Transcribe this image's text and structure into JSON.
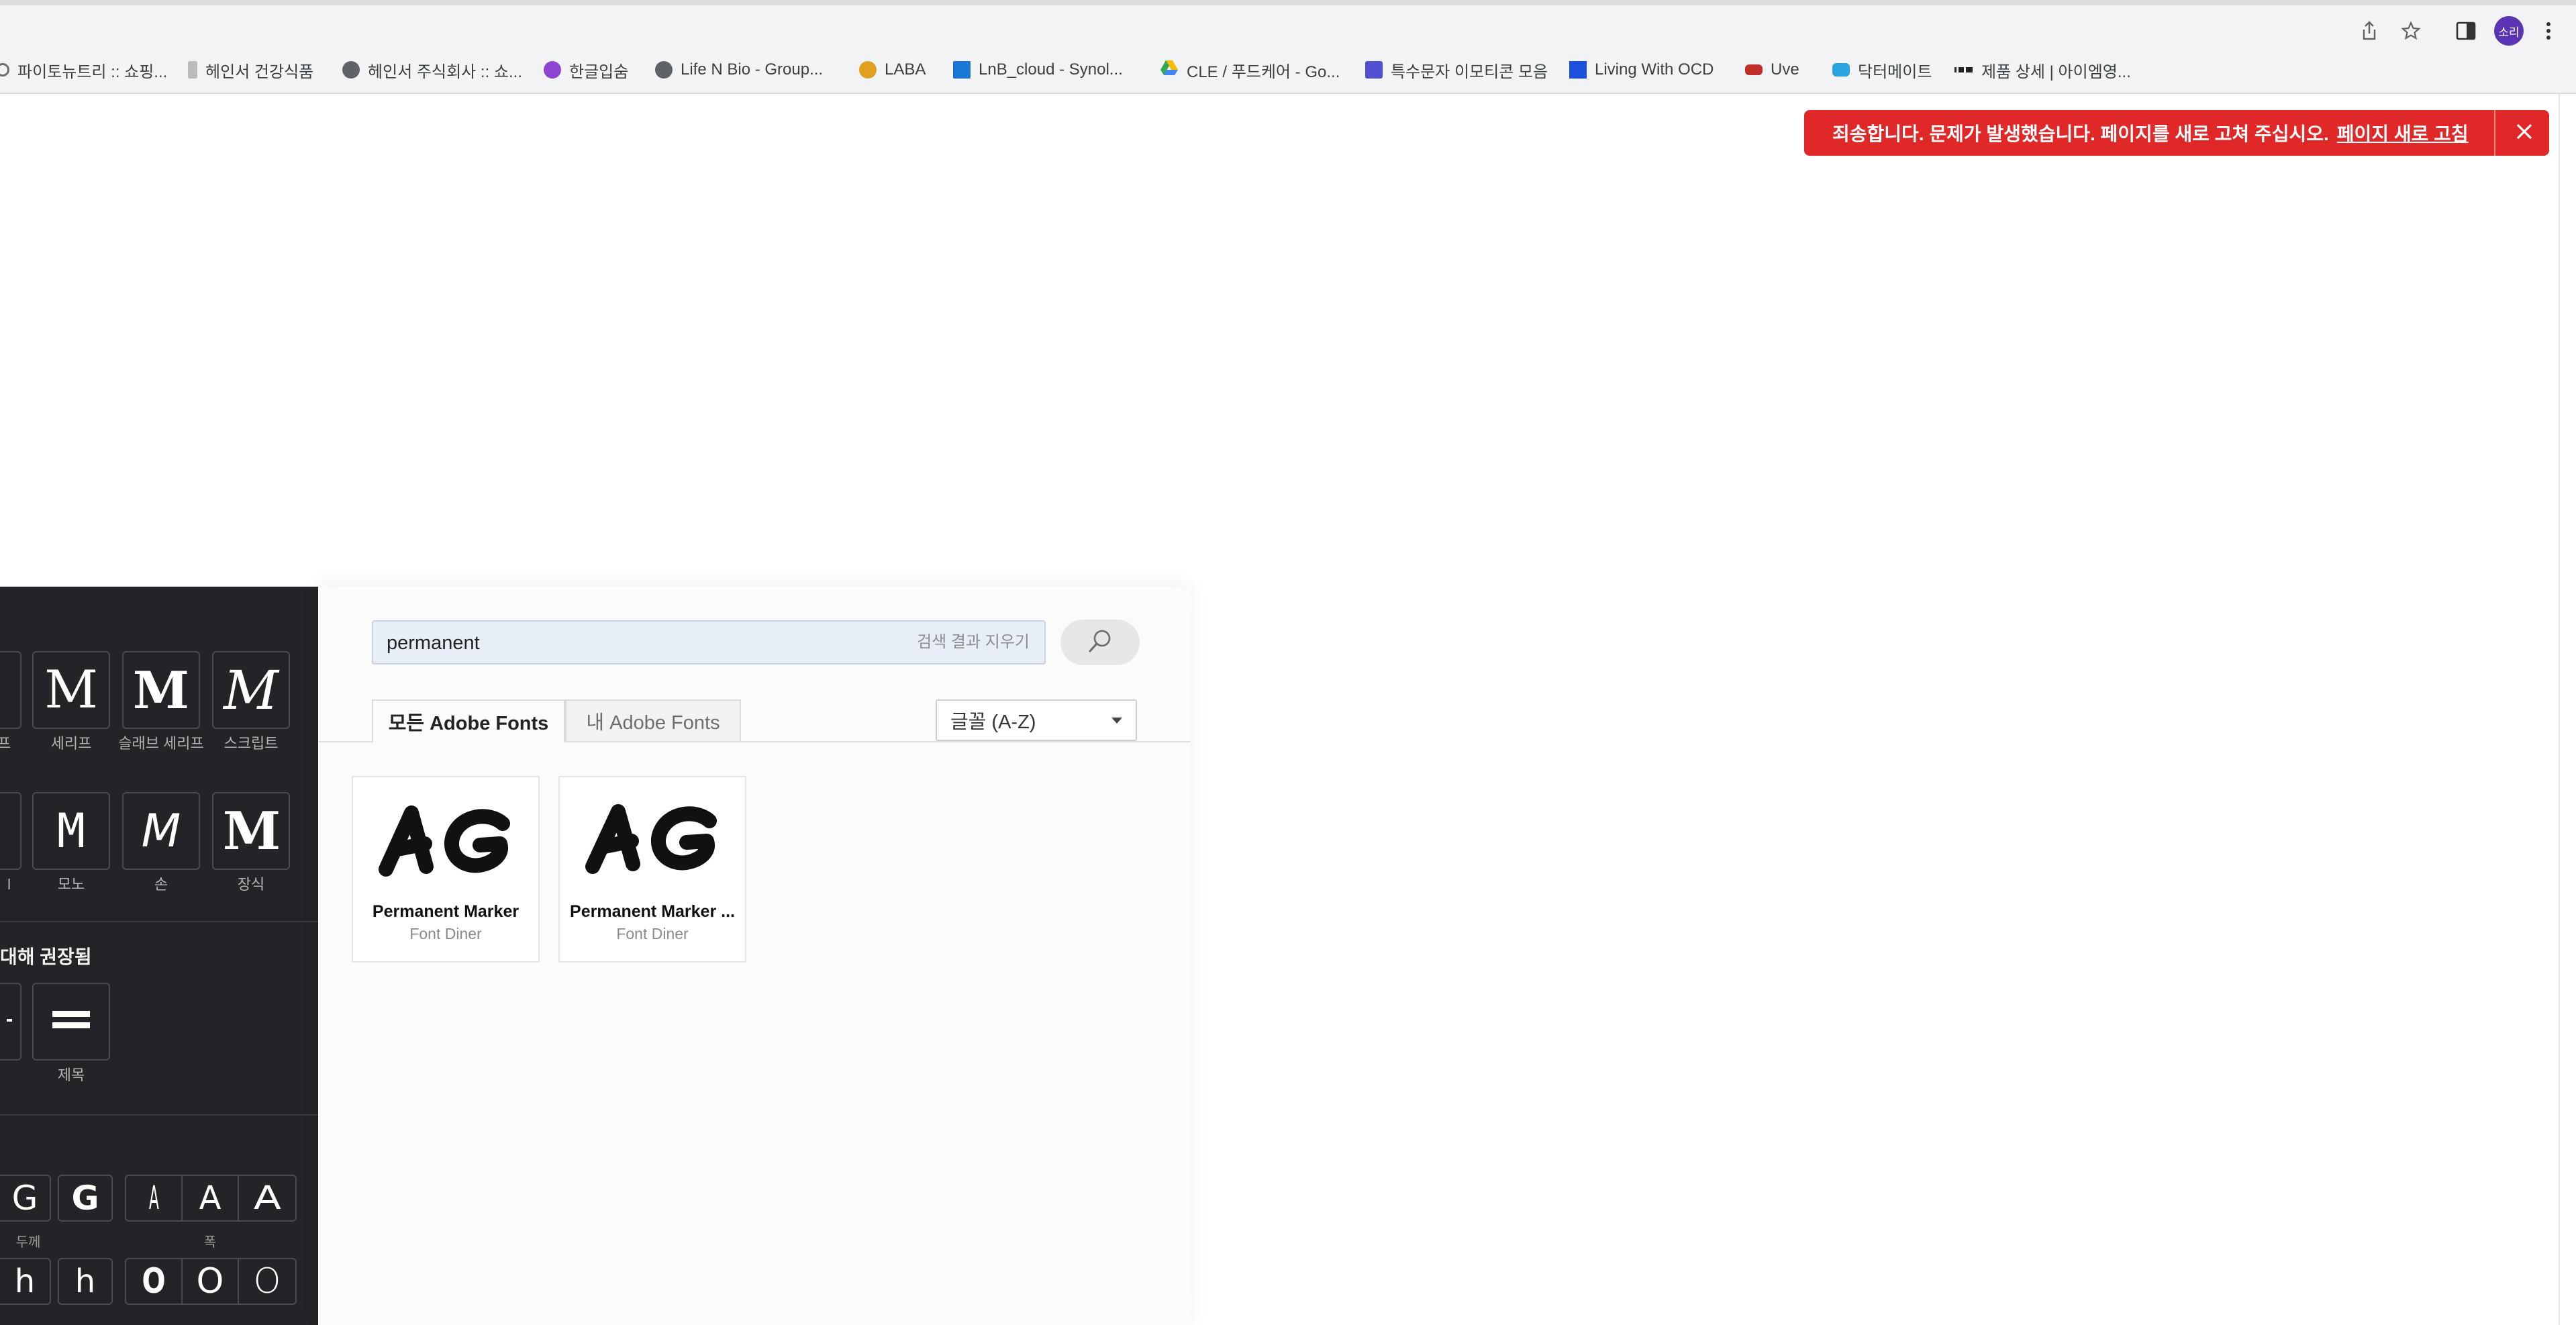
{
  "browser": {
    "avatar_text": "소리",
    "bookmarks": [
      {
        "label": "파이토뉴트리 :: 쇼핑...",
        "icon": "shopping-favicon",
        "color": "#6b6b6b"
      },
      {
        "label": "헤인서 건강식품",
        "icon": "bottle-favicon",
        "color": "#9b9b9b"
      },
      {
        "label": "헤인서 주식회사 :: 쇼...",
        "icon": "globe-icon",
        "color": "#5f6368"
      },
      {
        "label": "한글입숨",
        "icon": "hangul-favicon",
        "color": "#7b3fc4"
      },
      {
        "label": "Life N Bio - Group...",
        "icon": "globe-icon",
        "color": "#5f6368"
      },
      {
        "label": "LABA",
        "icon": "laba-favicon",
        "color": "#e0a020"
      },
      {
        "label": "LnB_cloud - Synol...",
        "icon": "dsm-favicon",
        "color": "#1976d2"
      },
      {
        "label": "CLE / 푸드케어 - Go...",
        "icon": "google-drive-icon",
        "color": "#34a853"
      },
      {
        "label": "특수문자 이모티콘 모음",
        "icon": "un-favicon",
        "color": "#5050d0"
      },
      {
        "label": "Living With OCD",
        "icon": "blue-square-favicon",
        "color": "#1e4fd8"
      },
      {
        "label": "Uve",
        "icon": "uve-favicon",
        "color": "#c0302c"
      },
      {
        "label": "닥터메이트",
        "icon": "drmate-favicon",
        "color": "#2aa3e0"
      },
      {
        "label": "제품 상세 | 아이엠영...",
        "icon": "iam-favicon",
        "color": "#222222"
      }
    ]
  },
  "error_banner": {
    "message": "죄송합니다. 문제가 발생했습니다. 페이지를 새로 고쳐 주십시오.",
    "link": "페이지 새로 고침",
    "color": "#e02828"
  },
  "left_panel": {
    "classification_tiles": [
      {
        "glyph": "M",
        "label": "세리프"
      },
      {
        "glyph": "M",
        "label": "슬래브 세리프"
      },
      {
        "glyph": "M",
        "label": "스크립트"
      },
      {
        "glyph": "M",
        "label": "모노"
      },
      {
        "glyph": "M",
        "label": "손"
      },
      {
        "glyph": "M",
        "label": "장식"
      }
    ],
    "partial_labels": {
      "row1": "프",
      "row2": "l"
    },
    "recommended_heading": "대해 권장됨",
    "recommended_tile_label": "제목",
    "property_tiles": {
      "weight_label": "두께",
      "width_label": "폭",
      "row1": [
        "G",
        "G",
        "A",
        "A",
        "A"
      ],
      "row2": [
        "h",
        "h",
        "O",
        "O",
        "O"
      ]
    }
  },
  "main": {
    "search": {
      "value": "permanent",
      "clear_label": "검색 결과 지우기"
    },
    "tabs": [
      {
        "label": "모든 Adobe Fonts",
        "active": true
      },
      {
        "label": "내 Adobe Fonts",
        "active": false
      }
    ],
    "sort": {
      "selected": "글꼴 (A-Z)"
    },
    "results": [
      {
        "preview": "AG",
        "name": "Permanent Marker",
        "foundry": "Font Diner"
      },
      {
        "preview": "AG",
        "name": "Permanent Marker ...",
        "foundry": "Font Diner"
      }
    ]
  }
}
